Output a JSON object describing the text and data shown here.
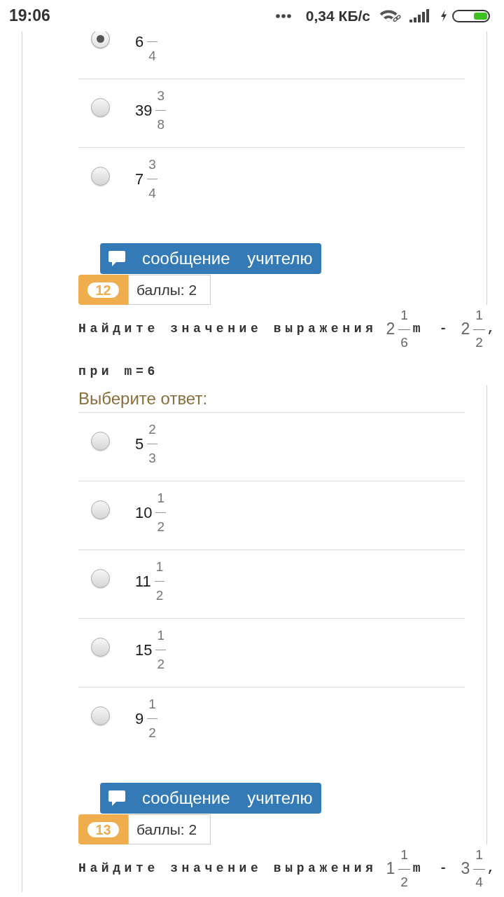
{
  "status_bar": {
    "time": "19:06",
    "network_speed": "0,34 КБ/с"
  },
  "questions": [
    {
      "answers": [
        {
          "whole": "6",
          "denominator": "4",
          "selected": true
        },
        {
          "whole": "39",
          "numerator": "3",
          "denominator": "8",
          "selected": false
        },
        {
          "whole": "7",
          "numerator": "3",
          "denominator": "4",
          "selected": false
        }
      ],
      "message_button": "сообщение учителю"
    },
    {
      "number": "12",
      "points": "баллы: 2",
      "prompt": "Найдите значение выражения",
      "expression": [
        {
          "kind": "mixed",
          "whole": "2",
          "numerator": "1",
          "denominator": "6"
        },
        {
          "kind": "variable",
          "text": "m"
        },
        {
          "kind": "operator",
          "text": "-"
        },
        {
          "kind": "mixed",
          "whole": "2",
          "numerator": "1",
          "denominator": "2"
        },
        {
          "kind": "punctuation",
          "text": ","
        }
      ],
      "condition": "при m=6",
      "answers_heading": "Выберите ответ:",
      "answers": [
        {
          "whole": "5",
          "numerator": "2",
          "denominator": "3",
          "selected": false
        },
        {
          "whole": "10",
          "numerator": "1",
          "denominator": "2",
          "selected": false
        },
        {
          "whole": "11",
          "numerator": "1",
          "denominator": "2",
          "selected": false
        },
        {
          "whole": "15",
          "numerator": "1",
          "denominator": "2",
          "selected": false
        },
        {
          "whole": "9",
          "numerator": "1",
          "denominator": "2",
          "selected": false
        }
      ],
      "message_button": "сообщение учителю"
    },
    {
      "number": "13",
      "points": "баллы: 2",
      "prompt": "Найдите значение выражения",
      "expression": [
        {
          "kind": "mixed",
          "whole": "1",
          "numerator": "1",
          "denominator": "2"
        },
        {
          "kind": "variable",
          "text": "m"
        },
        {
          "kind": "operator",
          "text": "-"
        },
        {
          "kind": "mixed",
          "whole": "3",
          "numerator": "1",
          "denominator": "4"
        },
        {
          "kind": "punctuation",
          "text": ","
        }
      ]
    }
  ]
}
